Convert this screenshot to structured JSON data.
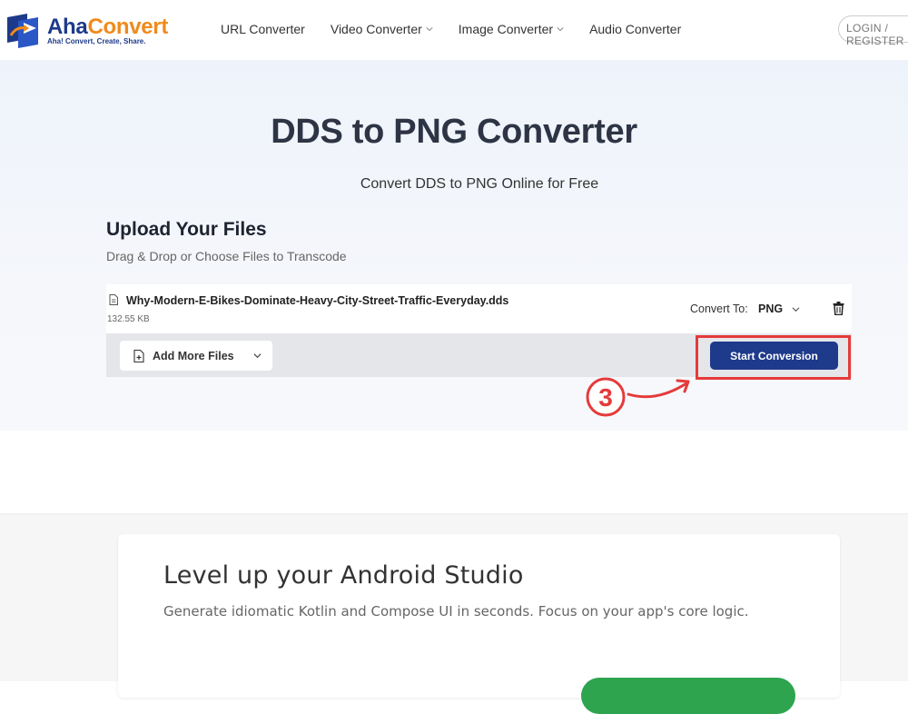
{
  "brand": {
    "name_part1": "Aha",
    "name_part2": "Convert",
    "tagline": "Aha! Convert, Create, Share.",
    "primary_color": "#1d3a8a",
    "accent_color": "#f08a1c"
  },
  "nav": {
    "items": [
      {
        "label": "URL Converter",
        "has_dropdown": false
      },
      {
        "label": "Video Converter",
        "has_dropdown": true
      },
      {
        "label": "Image Converter",
        "has_dropdown": true
      },
      {
        "label": "Audio Converter",
        "has_dropdown": false
      }
    ],
    "login_label": "LOGIN / REGISTER"
  },
  "hero": {
    "title": "DDS to PNG Converter",
    "subtitle": "Convert DDS to PNG Online for Free"
  },
  "upload": {
    "title": "Upload Your Files",
    "subtitle": "Drag & Drop or Choose Files to Transcode",
    "file": {
      "name": "Why-Modern-E-Bikes-Dominate-Heavy-City-Street-Traffic-Everyday.dds",
      "size": "132.55 KB",
      "convert_label": "Convert To:",
      "convert_value": "PNG"
    },
    "add_more_label": "Add More Files",
    "start_label": "Start Conversion",
    "start_button_color": "#1e3a8a"
  },
  "annotation": {
    "step_number": "3",
    "highlight_color": "#e53a3a"
  },
  "ad": {
    "title": "Level up your Android Studio",
    "subtitle": "Generate idiomatic Kotlin and Compose UI in seconds. Focus on your app's core logic.",
    "button_color": "#2ea44f"
  }
}
